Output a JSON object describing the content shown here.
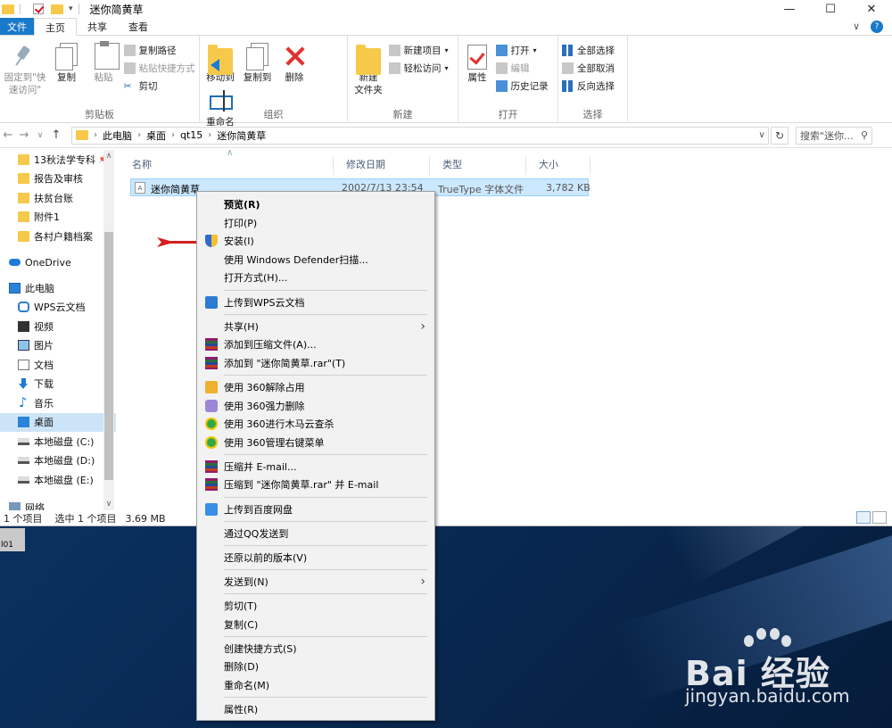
{
  "window": {
    "title": "迷你简黄草",
    "controls": [
      "—",
      "☐",
      "✕"
    ]
  },
  "ribbon_tabs": [
    {
      "label": "文件"
    },
    {
      "label": "主页"
    },
    {
      "label": "共享"
    },
    {
      "label": "查看"
    }
  ],
  "ribbon_right": {
    "collapse": "∨",
    "help": "?"
  },
  "ribbon": {
    "clipboard": {
      "label": "剪贴板",
      "pin": "固定到\"快\n速访问\"",
      "copy": "复制",
      "paste": "粘贴",
      "copy_path": "复制路径",
      "paste_shortcut": "粘贴快捷方式",
      "cut": "剪切"
    },
    "organize": {
      "label": "组织",
      "move_to": "移动到",
      "copy_to": "复制到",
      "delete": "删除",
      "rename": "重命名"
    },
    "new": {
      "label": "新建",
      "new_folder": "新建\n文件夹",
      "new_item": "新建项目",
      "easy_access": "轻松访问"
    },
    "open": {
      "label": "打开",
      "properties": "属性",
      "open": "打开",
      "edit": "编辑",
      "history": "历史记录"
    },
    "select": {
      "label": "选择",
      "select_all": "全部选择",
      "select_none": "全部取消",
      "invert": "反向选择"
    }
  },
  "address": {
    "crumbs": [
      "此电脑",
      "桌面",
      "qt15",
      "迷你简黄草"
    ],
    "search_placeholder": "搜索\"迷你..."
  },
  "nav_items": [
    {
      "label": "13秋法学专科",
      "icon": "folder-icon",
      "pinned": true
    },
    {
      "label": "报告及审核",
      "icon": "folder-icon"
    },
    {
      "label": "扶贫台账",
      "icon": "folder-icon"
    },
    {
      "label": "附件1",
      "icon": "folder-icon"
    },
    {
      "label": "各村户籍档案",
      "icon": "folder-icon"
    },
    {
      "label": "",
      "icon": ""
    },
    {
      "label": "OneDrive",
      "icon": "onedrive-icon"
    },
    {
      "label": "",
      "icon": ""
    },
    {
      "label": "此电脑",
      "icon": "pc-icon"
    },
    {
      "label": "WPS云文档",
      "icon": "wps-icon"
    },
    {
      "label": "视频",
      "icon": "video-icon"
    },
    {
      "label": "图片",
      "icon": "picture-icon"
    },
    {
      "label": "文档",
      "icon": "document-icon"
    },
    {
      "label": "下载",
      "icon": "download-icon"
    },
    {
      "label": "音乐",
      "icon": "music-icon"
    },
    {
      "label": "桌面",
      "icon": "desktop-icon",
      "selected": true
    },
    {
      "label": "本地磁盘 (C:)",
      "icon": "disk-icon"
    },
    {
      "label": "本地磁盘 (D:)",
      "icon": "disk-icon"
    },
    {
      "label": "本地磁盘 (E:)",
      "icon": "disk-icon"
    },
    {
      "label": "",
      "icon": ""
    },
    {
      "label": "网络",
      "icon": "network-icon"
    }
  ],
  "columns": {
    "name": "名称",
    "modified": "修改日期",
    "type": "类型",
    "size": "大小"
  },
  "file": {
    "name": "迷你简黄草",
    "modified": "2002/7/13 23:54",
    "type": "TrueType 字体文件",
    "size": "3,782 KB"
  },
  "status": {
    "items": "1 个项目",
    "selected": "选中 1 个项目",
    "size": "3.69 MB"
  },
  "desktop_icon_label": "l01",
  "context_menu": [
    {
      "label": "预览(R)",
      "bold": true
    },
    {
      "label": "打印(P)"
    },
    {
      "label": "安装(I)",
      "icon": "shield"
    },
    {
      "label": "使用 Windows Defender扫描..."
    },
    {
      "label": "打开方式(H)..."
    },
    {
      "sep": true
    },
    {
      "label": "上传到WPS云文档",
      "icon": "wps"
    },
    {
      "sep": true
    },
    {
      "label": "共享(H)",
      "submenu": true
    },
    {
      "label": "添加到压缩文件(A)...",
      "icon": "rar"
    },
    {
      "label": "添加到 \"迷你简黄草.rar\"(T)",
      "icon": "rar"
    },
    {
      "sep": true
    },
    {
      "label": "使用 360解除占用",
      "icon": "s360a"
    },
    {
      "label": "使用 360强力删除",
      "icon": "s360b"
    },
    {
      "label": "使用 360进行木马云查杀",
      "icon": "s360c"
    },
    {
      "label": "使用 360管理右键菜单",
      "icon": "s360c"
    },
    {
      "sep": true
    },
    {
      "label": "压缩并 E-mail...",
      "icon": "rar"
    },
    {
      "label": "压缩到 \"迷你简黄草.rar\" 并 E-mail",
      "icon": "rar"
    },
    {
      "sep": true
    },
    {
      "label": "上传到百度网盘",
      "icon": "bd"
    },
    {
      "sep": true
    },
    {
      "label": "通过QQ发送到"
    },
    {
      "sep": true
    },
    {
      "label": "还原以前的版本(V)"
    },
    {
      "sep": true
    },
    {
      "label": "发送到(N)",
      "submenu": true
    },
    {
      "sep": true
    },
    {
      "label": "剪切(T)"
    },
    {
      "label": "复制(C)"
    },
    {
      "sep": true
    },
    {
      "label": "创建快捷方式(S)"
    },
    {
      "label": "删除(D)"
    },
    {
      "label": "重命名(M)"
    },
    {
      "sep": true
    },
    {
      "label": "属性(R)"
    }
  ],
  "watermark": {
    "brand": "Bai 经验",
    "url": "jingyan.baidu.com"
  }
}
